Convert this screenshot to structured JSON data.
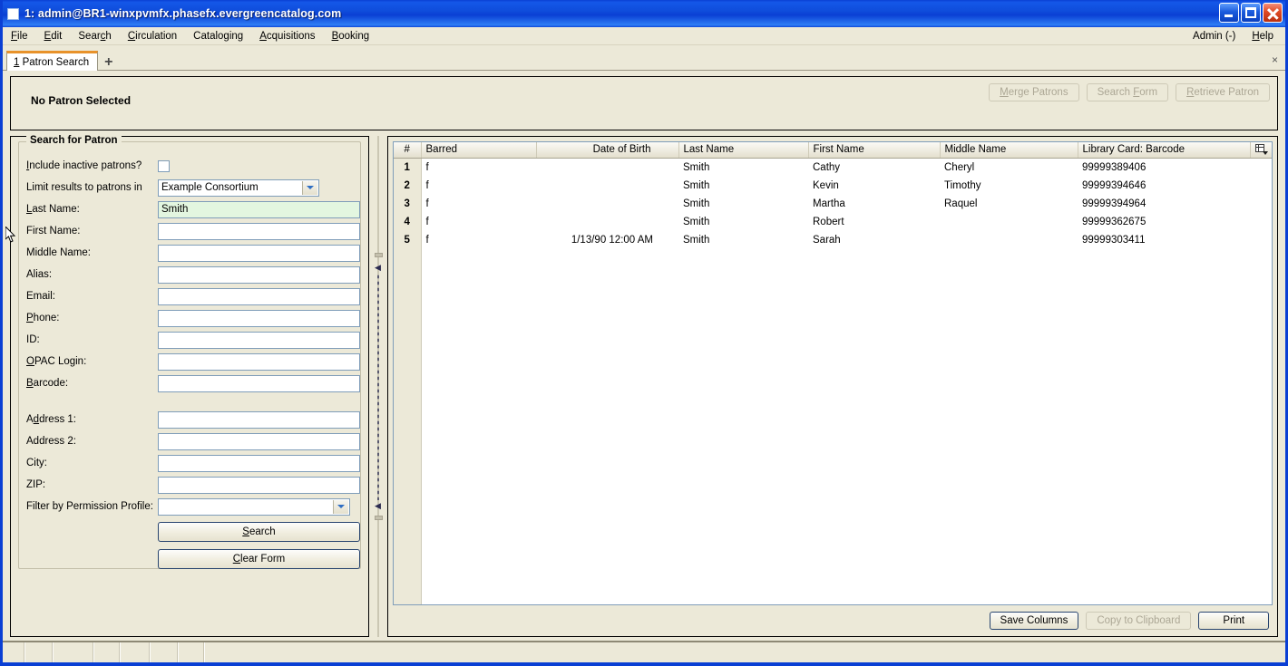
{
  "window": {
    "title": "1: admin@BR1-winxpvmfx.phasefx.evergreencatalog.com",
    "minimize_label": "Minimize",
    "maximize_label": "Maximize",
    "close_label": "Close"
  },
  "menubar": {
    "items": [
      {
        "label": "File",
        "mnemonic": "F"
      },
      {
        "label": "Edit",
        "mnemonic": "E"
      },
      {
        "label": "Search",
        "mnemonic": "c"
      },
      {
        "label": "Circulation",
        "mnemonic": "C"
      },
      {
        "label": "Cataloging",
        "mnemonic": "g"
      },
      {
        "label": "Acquisitions",
        "mnemonic": "A"
      },
      {
        "label": "Booking",
        "mnemonic": "B"
      }
    ],
    "right": [
      {
        "label": "Admin (-)",
        "mnemonic": ""
      },
      {
        "label": "Help",
        "mnemonic": "H"
      }
    ]
  },
  "tabs": {
    "items": [
      {
        "number": "1",
        "label": "Patron Search"
      }
    ],
    "new_tab_label": "+",
    "close_label": "×"
  },
  "patron_header": {
    "status": "No Patron Selected",
    "buttons": [
      {
        "label": "Merge Patrons",
        "mnemonic": "M",
        "disabled": true
      },
      {
        "label": "Search Form",
        "mnemonic": "F",
        "disabled": true
      },
      {
        "label": "Retrieve Patron",
        "mnemonic": "R",
        "disabled": true
      }
    ]
  },
  "search_form": {
    "legend": "Search for Patron",
    "fields": [
      {
        "label": "Include inactive patrons?",
        "mnemonic": "I",
        "type": "checkbox",
        "checked": false
      },
      {
        "label": "Limit results to patrons in",
        "mnemonic": "",
        "type": "select",
        "value": "Example Consortium"
      },
      {
        "label": "Last Name:",
        "mnemonic": "L",
        "type": "text",
        "value": "Smith",
        "focused": true
      },
      {
        "label": "First Name:",
        "mnemonic": "",
        "type": "text",
        "value": ""
      },
      {
        "label": "Middle Name:",
        "mnemonic": "",
        "type": "text",
        "value": ""
      },
      {
        "label": "Alias:",
        "mnemonic": "",
        "type": "text",
        "value": ""
      },
      {
        "label": "Email:",
        "mnemonic": "",
        "type": "text",
        "value": ""
      },
      {
        "label": "Phone:",
        "mnemonic": "P",
        "type": "text",
        "value": ""
      },
      {
        "label": "ID:",
        "mnemonic": "",
        "type": "text",
        "value": ""
      },
      {
        "label": "OPAC Login:",
        "mnemonic": "O",
        "type": "text",
        "value": ""
      },
      {
        "label": "Barcode:",
        "mnemonic": "B",
        "type": "text",
        "value": ""
      },
      {
        "label": "",
        "type": "spacer"
      },
      {
        "label": "Address 1:",
        "mnemonic": "d",
        "type": "text",
        "value": ""
      },
      {
        "label": "Address 2:",
        "mnemonic": "",
        "type": "text",
        "value": ""
      },
      {
        "label": "City:",
        "mnemonic": "",
        "type": "text",
        "value": ""
      },
      {
        "label": "ZIP:",
        "mnemonic": "",
        "type": "text",
        "value": ""
      },
      {
        "label": "Filter by Permission Profile:",
        "mnemonic": "",
        "type": "select",
        "value": ""
      }
    ],
    "search_button": "Search",
    "search_mnemonic": "S",
    "clear_button": "Clear Form",
    "clear_mnemonic": "C"
  },
  "results": {
    "columns": [
      "#",
      "Barred",
      "Date of Birth",
      "Last Name",
      "First Name",
      "Middle Name",
      "Library Card: Barcode"
    ],
    "column_picker_icon": "column-picker-icon",
    "rows": [
      {
        "num": "1",
        "barred": "f",
        "dob": "",
        "last": "Smith",
        "first": "Cathy",
        "middle": "Cheryl",
        "barcode": "99999389406"
      },
      {
        "num": "2",
        "barred": "f",
        "dob": "",
        "last": "Smith",
        "first": "Kevin",
        "middle": "Timothy",
        "barcode": "99999394646"
      },
      {
        "num": "3",
        "barred": "f",
        "dob": "",
        "last": "Smith",
        "first": "Martha",
        "middle": "Raquel",
        "barcode": "99999394964"
      },
      {
        "num": "4",
        "barred": "f",
        "dob": "",
        "last": "Smith",
        "first": "Robert",
        "middle": "",
        "barcode": "99999362675"
      },
      {
        "num": "5",
        "barred": "f",
        "dob": "1/13/90 12:00 AM",
        "last": "Smith",
        "first": "Sarah",
        "middle": "",
        "barcode": "99999303411"
      }
    ],
    "buttons": [
      {
        "label": "Save Columns",
        "disabled": false,
        "default": true
      },
      {
        "label": "Copy to Clipboard",
        "disabled": true,
        "default": false
      },
      {
        "label": "Print",
        "disabled": false,
        "default": true
      }
    ]
  },
  "statusbar": {
    "segments": [
      "",
      "",
      "",
      "",
      "",
      "",
      ""
    ]
  },
  "colors": {
    "titlebar_blue": "#0a3fd4",
    "chrome_beige": "#ece9d8",
    "field_border": "#7f9db9",
    "focused_field": "#e3f6e0",
    "tab_accent": "#e8922a"
  }
}
